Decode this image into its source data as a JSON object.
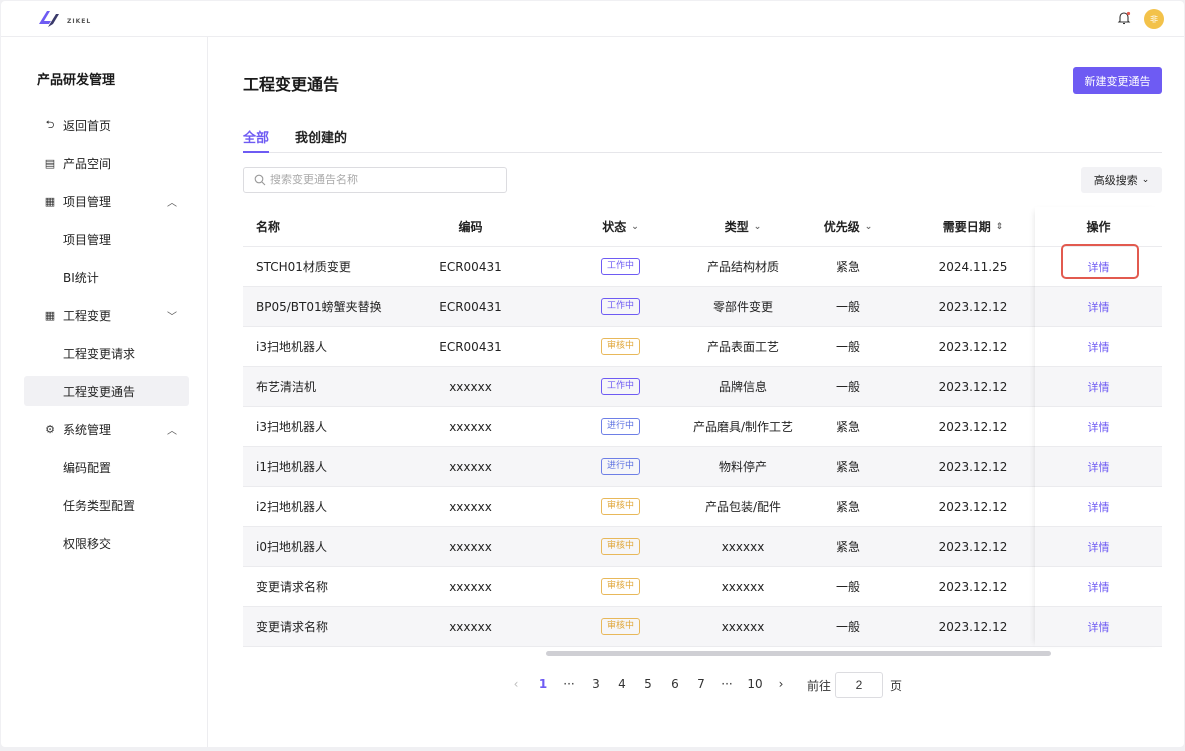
{
  "header": {
    "logo_text": "ZIKEL",
    "avatar_text": "非"
  },
  "sidebar": {
    "title": "产品研发管理",
    "items": [
      {
        "label": "返回首页",
        "icon": "back-icon"
      },
      {
        "label": "产品空间",
        "icon": "list-icon"
      },
      {
        "label": "项目管理",
        "icon": "grid-icon"
      },
      {
        "label": "项目管理"
      },
      {
        "label": "BI统计"
      },
      {
        "label": "工程变更",
        "icon": "grid-icon"
      },
      {
        "label": "工程变更请求"
      },
      {
        "label": "工程变更通告"
      },
      {
        "label": "系统管理",
        "icon": "gear-icon"
      },
      {
        "label": "编码配置"
      },
      {
        "label": "任务类型配置"
      },
      {
        "label": "权限移交"
      }
    ]
  },
  "main": {
    "title": "工程变更通告",
    "new_button": "新建变更通告",
    "tabs": [
      "全部",
      "我创建的"
    ],
    "search_placeholder": "搜索变更通告名称",
    "advanced_search": "高级搜索",
    "columns": [
      "名称",
      "编码",
      "状态",
      "类型",
      "优先级",
      "需要日期",
      "操作"
    ],
    "rows": [
      {
        "name": "STCH01材质变更",
        "code": "ECR00431",
        "status": "工作中",
        "type": "产品结构材质",
        "priority": "紧急",
        "date": "2024.11.25",
        "op": "详情"
      },
      {
        "name": "BP05/BT01螃蟹夹替换",
        "code": "ECR00431",
        "status": "工作中",
        "type": "零部件变更",
        "priority": "一般",
        "date": "2023.12.12",
        "op": "详情"
      },
      {
        "name": "i3扫地机器人",
        "code": "ECR00431",
        "status": "审核中",
        "type": "产品表面工艺",
        "priority": "一般",
        "date": "2023.12.12",
        "op": "详情"
      },
      {
        "name": "布艺清洁机",
        "code": "xxxxxx",
        "status": "工作中",
        "type": "品牌信息",
        "priority": "一般",
        "date": "2023.12.12",
        "op": "详情"
      },
      {
        "name": "i3扫地机器人",
        "code": "xxxxxx",
        "status": "进行中",
        "type": "产品磨具/制作工艺",
        "priority": "紧急",
        "date": "2023.12.12",
        "op": "详情"
      },
      {
        "name": "i1扫地机器人",
        "code": "xxxxxx",
        "status": "进行中",
        "type": "物料停产",
        "priority": "紧急",
        "date": "2023.12.12",
        "op": "详情"
      },
      {
        "name": "i2扫地机器人",
        "code": "xxxxxx",
        "status": "审核中",
        "type": "产品包装/配件",
        "priority": "紧急",
        "date": "2023.12.12",
        "op": "详情"
      },
      {
        "name": "i0扫地机器人",
        "code": "xxxxxx",
        "status": "审核中",
        "type": "xxxxxx",
        "priority": "紧急",
        "date": "2023.12.12",
        "op": "详情"
      },
      {
        "name": "变更请求名称",
        "code": "xxxxxx",
        "status": "审核中",
        "type": "xxxxxx",
        "priority": "一般",
        "date": "2023.12.12",
        "op": "详情"
      },
      {
        "name": "变更请求名称",
        "code": "xxxxxx",
        "status": "审核中",
        "type": "xxxxxx",
        "priority": "一般",
        "date": "2023.12.12",
        "op": "详情"
      }
    ],
    "pagination": {
      "prev": "‹",
      "next": "›",
      "ellipsis": "···",
      "pages": [
        "1",
        "3",
        "4",
        "5",
        "6",
        "7",
        "10"
      ],
      "current": "1",
      "goto_label": "前往",
      "goto_value": "2",
      "page_suffix": "页"
    }
  },
  "colors": {
    "accent": "#6e5bf3",
    "review": "#e0a73a",
    "highlight": "#e25a4f"
  }
}
